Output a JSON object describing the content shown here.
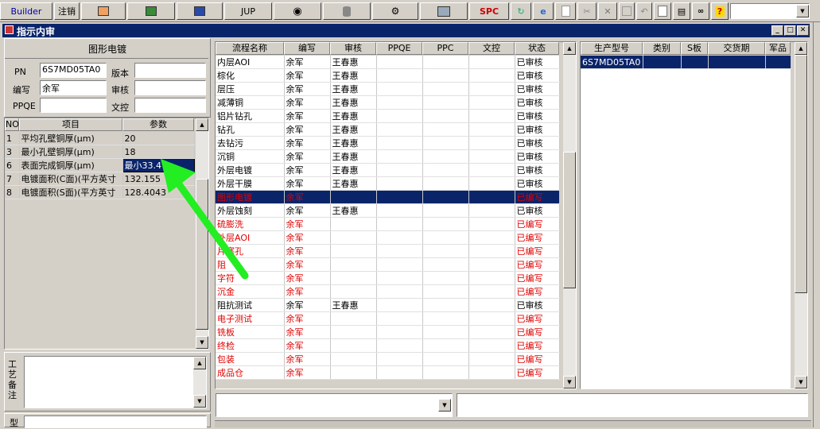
{
  "toolbar": {
    "builder": "Builder",
    "logout": "注销",
    "jup": "JUP",
    "spc": "SPC"
  },
  "window": {
    "title": "指示内审"
  },
  "left": {
    "section_title": "图形电镀",
    "fields": {
      "pn_label": "PN",
      "pn_value": "6S7MD05TA0",
      "version_label": "版本",
      "author_label": "编写",
      "author_value": "余军",
      "reviewer_label": "审核",
      "ppqe_label": "PPQE",
      "docctrl_label": "文控"
    },
    "param_headers": [
      "NO",
      "项目",
      "参数"
    ],
    "params": [
      {
        "no": "1",
        "item": "平均孔壁铜厚(μm)",
        "value": "20"
      },
      {
        "no": "3",
        "item": "最小孔壁铜厚(μm)",
        "value": "18"
      },
      {
        "no": "6",
        "item": "表面完成铜厚(μm)",
        "value": "最小33.4"
      },
      {
        "no": "7",
        "item": "电镀面积(C面)(平方英寸",
        "value": "132.155"
      },
      {
        "no": "8",
        "item": "电镀面积(S面)(平方英寸",
        "value": "128.4043"
      }
    ],
    "notes_label": "工艺备注",
    "type_label": "型"
  },
  "flow": {
    "headers": [
      "流程名称",
      "编写",
      "审核",
      "PPQE",
      "PPC",
      "文控",
      "状态"
    ],
    "rows": [
      {
        "name": "内层AOI",
        "author": "余军",
        "reviewer": "王春惠",
        "status": "已审核",
        "red": false
      },
      {
        "name": "棕化",
        "author": "余军",
        "reviewer": "王春惠",
        "status": "已审核",
        "red": false
      },
      {
        "name": "层压",
        "author": "余军",
        "reviewer": "王春惠",
        "status": "已审核",
        "red": false
      },
      {
        "name": "减薄铜",
        "author": "余军",
        "reviewer": "王春惠",
        "status": "已审核",
        "red": false
      },
      {
        "name": "铝片钻孔",
        "author": "余军",
        "reviewer": "王春惠",
        "status": "已审核",
        "red": false
      },
      {
        "name": "钻孔",
        "author": "余军",
        "reviewer": "王春惠",
        "status": "已审核",
        "red": false
      },
      {
        "name": "去钻污",
        "author": "余军",
        "reviewer": "王春惠",
        "status": "已审核",
        "red": false
      },
      {
        "name": "沉铜",
        "author": "余军",
        "reviewer": "王春惠",
        "status": "已审核",
        "red": false
      },
      {
        "name": "外层电镀",
        "author": "余军",
        "reviewer": "王春惠",
        "status": "已审核",
        "red": false
      },
      {
        "name": "外层干膜",
        "author": "余军",
        "reviewer": "王春惠",
        "status": "已审核",
        "red": false
      },
      {
        "name": "图形电镀",
        "author": "余军",
        "reviewer": "",
        "status": "已编写",
        "red": true,
        "selected": true
      },
      {
        "name": "外层蚀刻",
        "author": "余军",
        "reviewer": "王春惠",
        "status": "已审核",
        "red": false
      },
      {
        "name": "硫膨洗",
        "author": "余军",
        "reviewer": "",
        "status": "已编写",
        "red": true
      },
      {
        "name": "外层AOI",
        "author": "余军",
        "reviewer": "",
        "status": "已编写",
        "red": true
      },
      {
        "name": "片塞孔",
        "author": "余军",
        "reviewer": "",
        "status": "已编写",
        "red": true
      },
      {
        "name": "阻",
        "author": "余军",
        "reviewer": "",
        "status": "已编写",
        "red": true
      },
      {
        "name": "字符",
        "author": "余军",
        "reviewer": "",
        "status": "已编写",
        "red": true
      },
      {
        "name": "沉金",
        "author": "余军",
        "reviewer": "",
        "status": "已编写",
        "red": true
      },
      {
        "name": "阻抗测试",
        "author": "余军",
        "reviewer": "王春惠",
        "status": "已审核",
        "red": false
      },
      {
        "name": "电子测试",
        "author": "余军",
        "reviewer": "",
        "status": "已编写",
        "red": true
      },
      {
        "name": "铣板",
        "author": "余军",
        "reviewer": "",
        "status": "已编写",
        "red": true
      },
      {
        "name": "终检",
        "author": "余军",
        "reviewer": "",
        "status": "已编写",
        "red": true
      },
      {
        "name": "包装",
        "author": "余军",
        "reviewer": "",
        "status": "已编写",
        "red": true
      },
      {
        "name": "成品仓",
        "author": "余军",
        "reviewer": "",
        "status": "已编写",
        "red": true
      }
    ]
  },
  "product": {
    "headers": [
      "生产型号",
      "类别",
      "S板",
      "交货期",
      "军品"
    ],
    "rows": [
      {
        "model": "6S7MD05TA0"
      }
    ]
  },
  "colors": {
    "selection": "#0a246a",
    "red_text": "#e00000",
    "arrow": "#22ee22"
  }
}
